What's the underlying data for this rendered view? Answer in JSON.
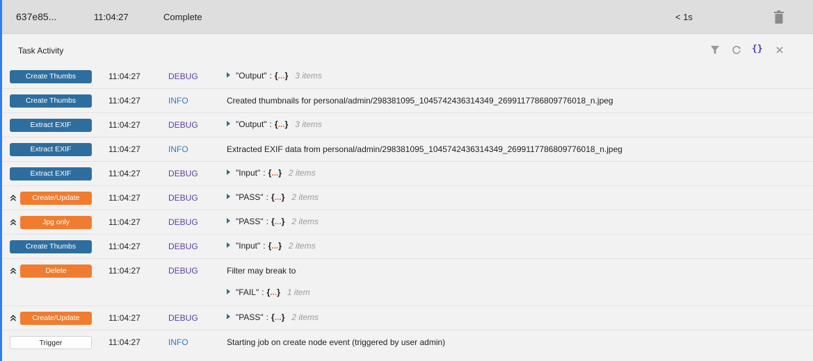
{
  "job": {
    "id": "637e85...",
    "time": "11:04:27",
    "status": "Complete",
    "duration": "< 1s"
  },
  "activity": {
    "title": "Task Activity",
    "json_toggle": "{}",
    "rows": [
      {
        "tag": "Create Thumbs",
        "time": "11:04:27",
        "level": "DEBUG",
        "json": {
          "key": "\"Output\"",
          "sep": ":",
          "open": "{",
          "dots": "...",
          "close": "}",
          "count": "3 items"
        }
      },
      {
        "tag": "Create Thumbs",
        "time": "11:04:27",
        "level": "INFO",
        "message": "Created thumbnails for personal/admin/298381095_1045742436314349_2699117786809776018_n.jpeg"
      },
      {
        "tag": "Extract EXIF",
        "time": "11:04:27",
        "level": "DEBUG",
        "json": {
          "key": "\"Output\"",
          "sep": ":",
          "open": "{",
          "dots": "...",
          "close": "}",
          "count": "3 items"
        }
      },
      {
        "tag": "Extract EXIF",
        "time": "11:04:27",
        "level": "INFO",
        "message": "Extracted EXIF data from personal/admin/298381095_1045742436314349_2699117786809776018_n.jpeg"
      },
      {
        "tag": "Extract EXIF",
        "time": "11:04:27",
        "level": "DEBUG",
        "json": {
          "key": "\"Input\"",
          "sep": ":",
          "open": "{",
          "dots": "...",
          "close": "}",
          "count": "2 items"
        }
      },
      {
        "tag": "Create/Update",
        "time": "11:04:27",
        "level": "DEBUG",
        "json": {
          "key": "\"PASS\"",
          "sep": ":",
          "open": "{",
          "dots": "...",
          "close": "}",
          "count": "2 items"
        }
      },
      {
        "tag": "Jpg only",
        "time": "11:04:27",
        "level": "DEBUG",
        "json": {
          "key": "\"PASS\"",
          "sep": ":",
          "open": "{",
          "dots": "...",
          "close": "}",
          "count": "2 items"
        }
      },
      {
        "tag": "Create Thumbs",
        "time": "11:04:27",
        "level": "DEBUG",
        "json": {
          "key": "\"Input\"",
          "sep": ":",
          "open": "{",
          "dots": "...",
          "close": "}",
          "count": "2 items"
        }
      },
      {
        "tag": "Delete",
        "time": "11:04:27",
        "level": "DEBUG",
        "message": "Filter may break to",
        "json": {
          "key": "\"FAIL\"",
          "sep": ":",
          "open": "{",
          "dots": "...",
          "close": "}",
          "count": "1 item"
        }
      },
      {
        "tag": "Create/Update",
        "time": "11:04:27",
        "level": "DEBUG",
        "json": {
          "key": "\"PASS\"",
          "sep": ":",
          "open": "{",
          "dots": "...",
          "close": "}",
          "count": "2 items"
        }
      },
      {
        "tag": "Trigger",
        "time": "11:04:27",
        "level": "INFO",
        "message": "Starting job on create node event (triggered by user admin)"
      }
    ]
  },
  "colors": {
    "accent": "#2f80ed",
    "tag_blue": "#2e6e9e",
    "tag_orange": "#f07c30",
    "debug": "#5a3fa6",
    "info": "#2e79c1"
  }
}
